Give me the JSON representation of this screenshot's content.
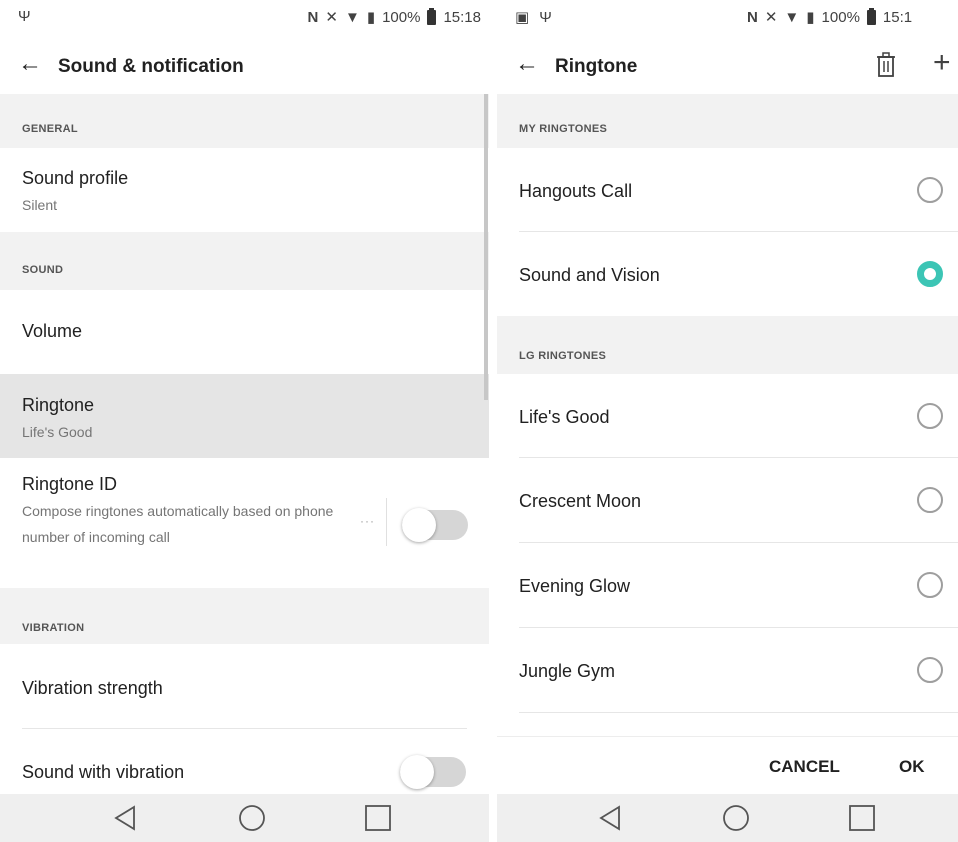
{
  "left": {
    "status": {
      "right_text": "100%",
      "time": "15:18"
    },
    "appbar": {
      "back_icon": "arrow-left-icon",
      "title": "Sound & notification"
    },
    "sections": {
      "general": "GENERAL",
      "sound": "SOUND",
      "vibration": "VIBRATION"
    },
    "items": {
      "sound_profile": {
        "title": "Sound profile",
        "value": "Silent"
      },
      "volume": {
        "title": "Volume"
      },
      "ringtone": {
        "title": "Ringtone",
        "value": "Life's Good"
      },
      "ringtone_id": {
        "title": "Ringtone ID",
        "description": "Compose ringtones automatically based on phone number of incoming call",
        "toggle": false
      },
      "vibration_strength": {
        "title": "Vibration strength"
      },
      "sound_with_vibration": {
        "title": "Sound with vibration",
        "toggle": false
      }
    }
  },
  "right": {
    "status": {
      "right_text": "100%",
      "time": "15:1"
    },
    "appbar": {
      "back_icon": "arrow-left-icon",
      "title": "Ringtone",
      "delete_icon": "trash-icon",
      "add_icon": "plus-icon"
    },
    "sections": {
      "my": "MY RINGTONES",
      "lg": "LG RINGTONES"
    },
    "my_ringtones": [
      {
        "label": "Hangouts Call",
        "selected": false
      },
      {
        "label": "Sound and Vision",
        "selected": true
      }
    ],
    "lg_ringtones": [
      {
        "label": "Life's Good",
        "selected": false
      },
      {
        "label": "Crescent Moon",
        "selected": false
      },
      {
        "label": "Evening Glow",
        "selected": false
      },
      {
        "label": "Jungle Gym",
        "selected": false
      }
    ],
    "actions": {
      "cancel": "CANCEL",
      "ok": "OK"
    }
  },
  "nav": {
    "back": "nav-back-icon",
    "home": "nav-home-icon",
    "recents": "nav-recents-icon"
  },
  "colors": {
    "accent": "#3cc5b5",
    "header_bg": "#f2f2f2",
    "selected_bg": "#e5e5e5",
    "nav_bg": "#efefef"
  }
}
